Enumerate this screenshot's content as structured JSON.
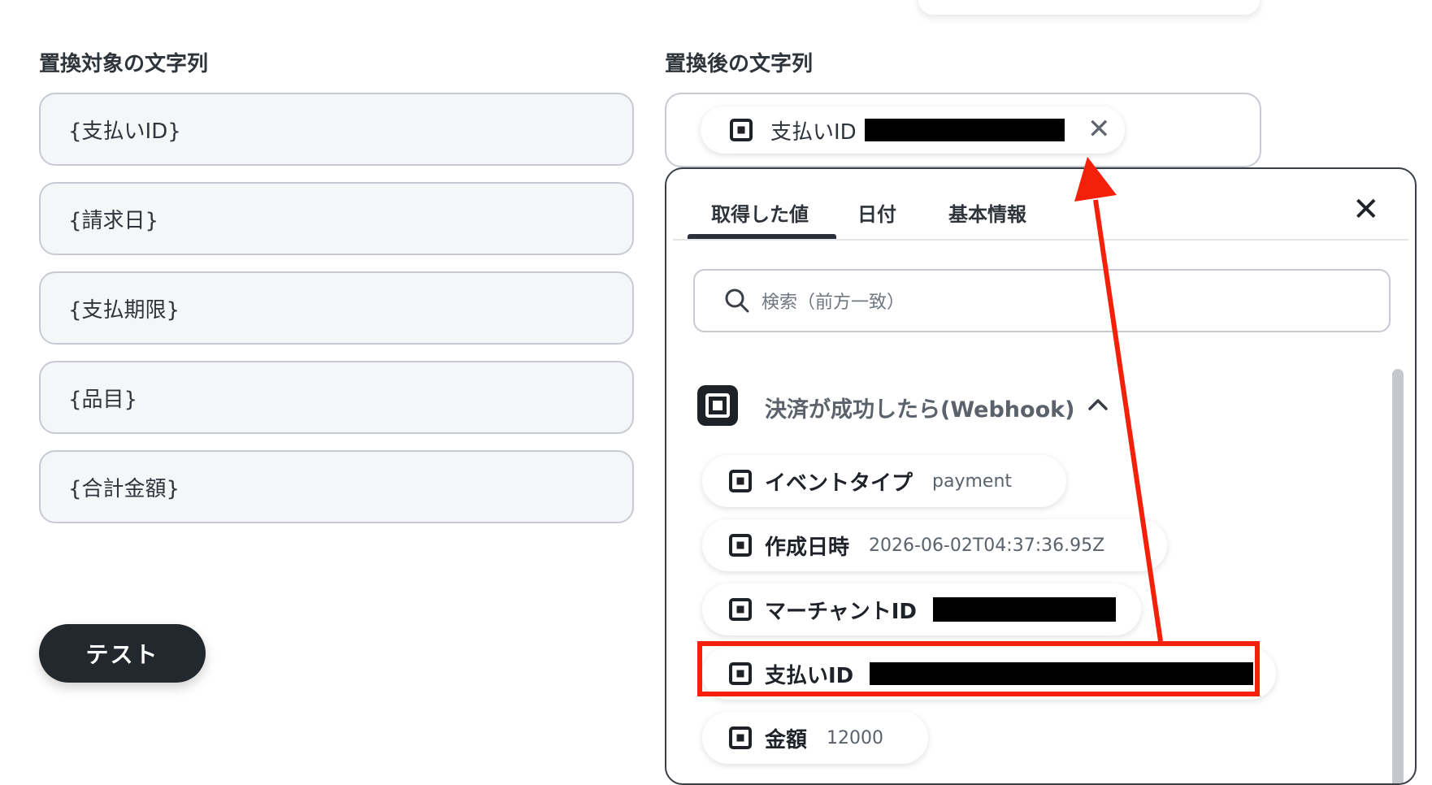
{
  "left_column": {
    "label": "置換対象の文字列",
    "fields": [
      "{支払いID}",
      "{請求日}",
      "{支払期限}",
      "{品目}",
      "{合計金額}"
    ]
  },
  "right_column": {
    "label": "置換後の文字列",
    "chip": {
      "label": "支払いID",
      "icon": "square-app-icon",
      "value_redacted": true
    }
  },
  "panel": {
    "tabs": [
      "取得した値",
      "日付",
      "基本情報"
    ],
    "active_tab": "取得した値",
    "search_placeholder": "検索（前方一致）",
    "group": {
      "title": "決済が成功したら(Webhook)",
      "expanded": true,
      "items": [
        {
          "label": "イベントタイプ",
          "value": "payment"
        },
        {
          "label": "作成日時",
          "value": "2026-06-02T04:37:36.95Z"
        },
        {
          "label": "マーチャントID",
          "value": "",
          "redacted": true
        },
        {
          "label": "支払いID",
          "value": "",
          "redacted": true,
          "highlighted": true
        },
        {
          "label": "金額",
          "value": "12000"
        }
      ]
    }
  },
  "test_button": {
    "label": "テスト"
  },
  "annotation": {
    "color": "#f5200a"
  },
  "colors": {
    "dark": "#23282f",
    "border": "#c7cbd1",
    "field_bg": "#f5f6f8",
    "highlight": "#f5200a"
  }
}
